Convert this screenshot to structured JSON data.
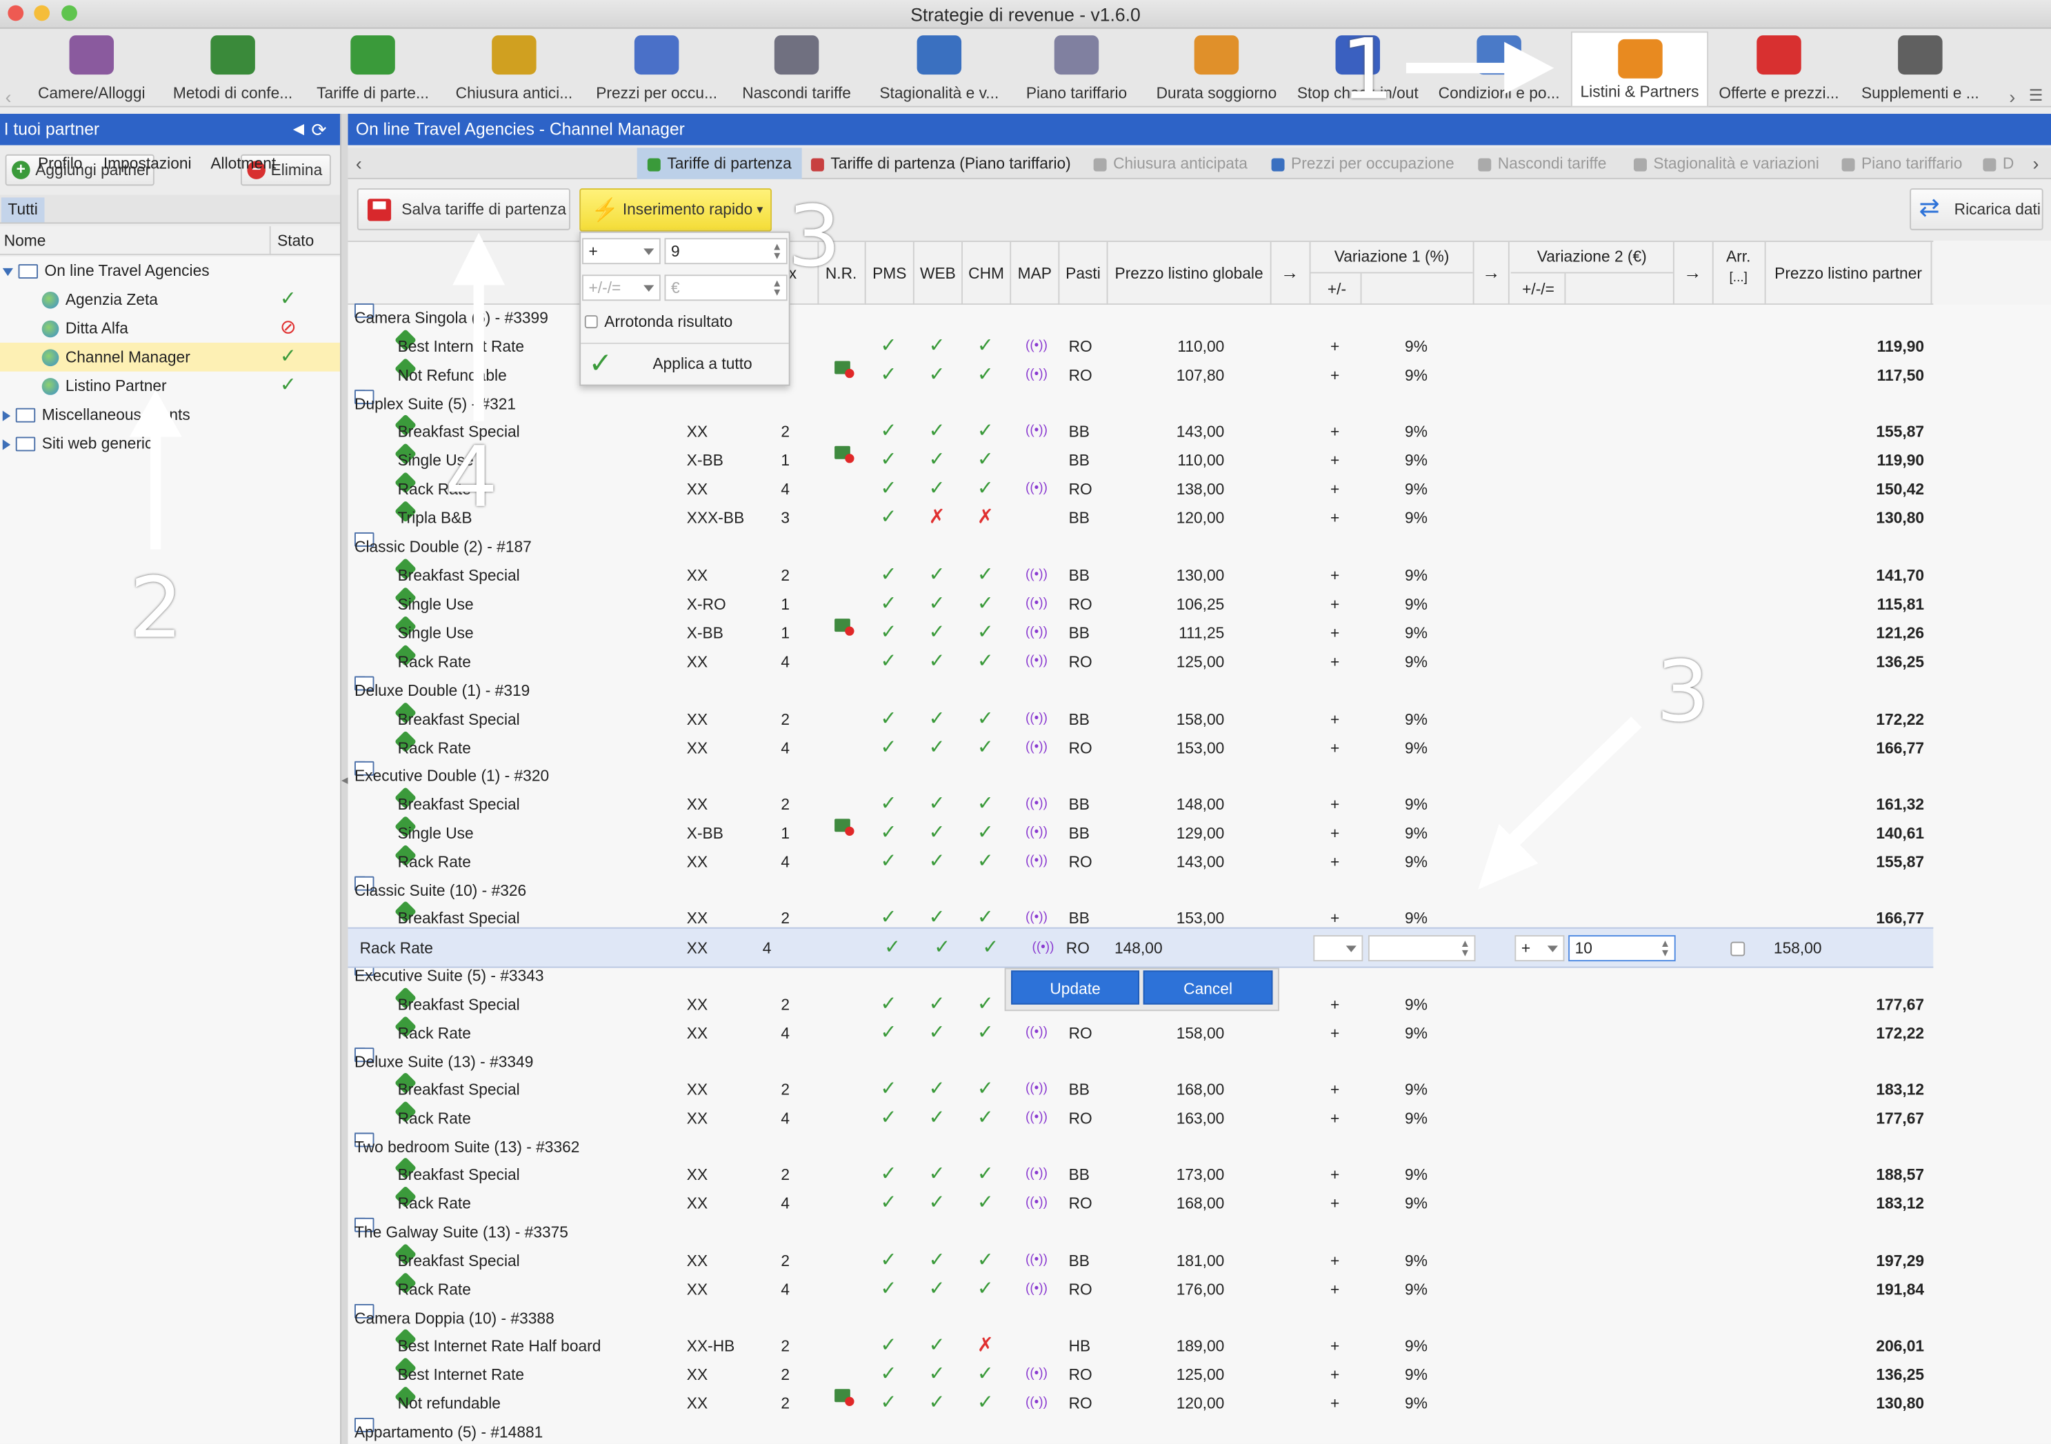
{
  "window": {
    "title": "Strategie di revenue - v1.6.0"
  },
  "toolbar": [
    {
      "label": "Camere/Alloggi",
      "icon": "bed-icon",
      "color": "#8a5a9e"
    },
    {
      "label": "Metodi di confe...",
      "icon": "money-icon",
      "color": "#3a8a3a"
    },
    {
      "label": "Tariffe di parte...",
      "icon": "price-tag-icon",
      "color": "#3a9a3a"
    },
    {
      "label": "Chiusura antici...",
      "icon": "clock-icon",
      "color": "#d0a020"
    },
    {
      "label": "Prezzi per occu...",
      "icon": "bar-chart-icon",
      "color": "#4a70c8"
    },
    {
      "label": "Nascondi tariffe",
      "icon": "hidden-eye-icon",
      "color": "#707080"
    },
    {
      "label": "Stagionalità e v...",
      "icon": "season-calendar-icon",
      "color": "#3a70c0"
    },
    {
      "label": "Piano tariffario",
      "icon": "calendar-grid-icon",
      "color": "#8080a0"
    },
    {
      "label": "Durata soggiorno",
      "icon": "ruler-calendar-icon",
      "color": "#e0902a"
    },
    {
      "label": "Stop check-in/out",
      "icon": "stop-icon",
      "color": "#3a60c0"
    },
    {
      "label": "Condizioni e po...",
      "icon": "document-icon",
      "color": "#4a7ac8"
    },
    {
      "label": "Listini & Partners",
      "icon": "handshake-icon",
      "color": "#e88a20"
    },
    {
      "label": "Offerte e prezzi...",
      "icon": "discount-icon",
      "color": "#d83030"
    },
    {
      "label": "Supplementi e ...",
      "icon": "service-bell-icon",
      "color": "#606060"
    }
  ],
  "sidebar": {
    "title": "I tuoi partner",
    "add_label": "Aggiungi partner",
    "delete_label": "Elimina",
    "filter_tab": "Tutti",
    "col_name": "Nome",
    "col_status": "Stato",
    "groups": [
      {
        "label": "On line Travel Agencies",
        "expanded": true,
        "items": [
          {
            "label": "Agenzia Zeta",
            "status": "✓"
          },
          {
            "label": "Ditta Alfa",
            "status": "⊘"
          },
          {
            "label": "Channel Manager",
            "status": "✓",
            "selected": true
          },
          {
            "label": "Listino Partner",
            "status": "✓"
          }
        ]
      },
      {
        "label": "Miscellaneous clients",
        "expanded": false,
        "items": []
      },
      {
        "label": "Siti web generici",
        "expanded": false,
        "items": []
      }
    ]
  },
  "main": {
    "title": "On line Travel Agencies - Channel Manager",
    "tabs": [
      "Profilo",
      "Impostazioni",
      "Allotment",
      "Tariffe di partenza",
      "Tariffe di partenza (Piano tariffario)",
      "Chiusura anticipata",
      "Prezzi per occupazione",
      "Nascondi tariffe",
      "Stagionalità e variazioni",
      "Piano tariffario",
      "D"
    ],
    "save_label": "Salva tariffe di partenza",
    "quick_label": "Inserimento rapido",
    "reload_label": "Ricarica dati",
    "columns": {
      "x": "x",
      "nr": "N.R.",
      "pms": "PMS",
      "web": "WEB",
      "chm": "CHM",
      "map": "MAP",
      "meals": "Pasti",
      "global": "Prezzo listino globale",
      "arrow": "→",
      "var1": "Variazione 1 (%)",
      "var1_sub": "+/-",
      "var2": "Variazione 2 (€)",
      "var2_sub": "+/-/=",
      "arr": "Arr.",
      "arr_sub": "[...]",
      "partner": "Prezzo listino partner"
    }
  },
  "quick_popup": {
    "op": "+",
    "value": "9",
    "op2_placeholder": "+/-/=",
    "value2_placeholder": "€",
    "round_label": "Arrotonda risultato",
    "apply_label": "Applica a tutto"
  },
  "rows": [
    {
      "type": "g",
      "label": "Camera Singola (6) - #3399"
    },
    {
      "type": "r",
      "label": "Best Internet Rate",
      "code": "",
      "occ": "",
      "nr": false,
      "pms": "✓",
      "web": "✓",
      "chm": "✓",
      "map": true,
      "meal": "RO",
      "price": "110,00",
      "v": "9%",
      "final": "119,90"
    },
    {
      "type": "r",
      "label": "Not Refundable",
      "code": "",
      "occ": "",
      "nr": true,
      "pms": "✓",
      "web": "✓",
      "chm": "✓",
      "map": true,
      "meal": "RO",
      "price": "107,80",
      "v": "9%",
      "final": "117,50"
    },
    {
      "type": "g",
      "label": "Duplex Suite (5) - #321"
    },
    {
      "type": "r",
      "label": "Breakfast Special",
      "code": "XX",
      "occ": "2",
      "nr": false,
      "pms": "✓",
      "web": "✓",
      "chm": "✓",
      "map": true,
      "meal": "BB",
      "price": "143,00",
      "v": "9%",
      "final": "155,87"
    },
    {
      "type": "r",
      "label": "Single Use",
      "code": "X-BB",
      "occ": "1",
      "nr": true,
      "pms": "✓",
      "web": "✓",
      "chm": "✓",
      "map": false,
      "meal": "BB",
      "price": "110,00",
      "v": "9%",
      "final": "119,90"
    },
    {
      "type": "r",
      "label": "Rack Rate",
      "code": "XX",
      "occ": "4",
      "nr": false,
      "pms": "✓",
      "web": "✓",
      "chm": "✓",
      "map": true,
      "meal": "RO",
      "price": "138,00",
      "v": "9%",
      "final": "150,42"
    },
    {
      "type": "r",
      "label": "Tripla B&B",
      "code": "XXX-BB",
      "occ": "3",
      "nr": false,
      "pms": "✓",
      "web": "✗",
      "chm": "✗",
      "map": false,
      "meal": "BB",
      "price": "120,00",
      "v": "9%",
      "final": "130,80"
    },
    {
      "type": "g",
      "label": "Classic Double (2) - #187"
    },
    {
      "type": "r",
      "label": "Breakfast Special",
      "code": "XX",
      "occ": "2",
      "nr": false,
      "pms": "✓",
      "web": "✓",
      "chm": "✓",
      "map": true,
      "meal": "BB",
      "price": "130,00",
      "v": "9%",
      "final": "141,70"
    },
    {
      "type": "r",
      "label": "Single Use",
      "code": "X-RO",
      "occ": "1",
      "nr": false,
      "pms": "✓",
      "web": "✓",
      "chm": "✓",
      "map": true,
      "meal": "RO",
      "price": "106,25",
      "v": "9%",
      "final": "115,81"
    },
    {
      "type": "r",
      "label": "Single Use",
      "code": "X-BB",
      "occ": "1",
      "nr": true,
      "pms": "✓",
      "web": "✓",
      "chm": "✓",
      "map": true,
      "meal": "BB",
      "price": "111,25",
      "v": "9%",
      "final": "121,26"
    },
    {
      "type": "r",
      "label": "Rack Rate",
      "code": "XX",
      "occ": "4",
      "nr": false,
      "pms": "✓",
      "web": "✓",
      "chm": "✓",
      "map": true,
      "meal": "RO",
      "price": "125,00",
      "v": "9%",
      "final": "136,25"
    },
    {
      "type": "g",
      "label": "Deluxe Double (1) - #319"
    },
    {
      "type": "r",
      "label": "Breakfast Special",
      "code": "XX",
      "occ": "2",
      "nr": false,
      "pms": "✓",
      "web": "✓",
      "chm": "✓",
      "map": true,
      "meal": "BB",
      "price": "158,00",
      "v": "9%",
      "final": "172,22"
    },
    {
      "type": "r",
      "label": "Rack Rate",
      "code": "XX",
      "occ": "4",
      "nr": false,
      "pms": "✓",
      "web": "✓",
      "chm": "✓",
      "map": true,
      "meal": "RO",
      "price": "153,00",
      "v": "9%",
      "final": "166,77"
    },
    {
      "type": "g",
      "label": "Executive Double (1) - #320"
    },
    {
      "type": "r",
      "label": "Breakfast Special",
      "code": "XX",
      "occ": "2",
      "nr": false,
      "pms": "✓",
      "web": "✓",
      "chm": "✓",
      "map": true,
      "meal": "BB",
      "price": "148,00",
      "v": "9%",
      "final": "161,32"
    },
    {
      "type": "r",
      "label": "Single Use",
      "code": "X-BB",
      "occ": "1",
      "nr": true,
      "pms": "✓",
      "web": "✓",
      "chm": "✓",
      "map": true,
      "meal": "BB",
      "price": "129,00",
      "v": "9%",
      "final": "140,61"
    },
    {
      "type": "r",
      "label": "Rack Rate",
      "code": "XX",
      "occ": "4",
      "nr": false,
      "pms": "✓",
      "web": "✓",
      "chm": "✓",
      "map": true,
      "meal": "RO",
      "price": "143,00",
      "v": "9%",
      "final": "155,87"
    },
    {
      "type": "g",
      "label": "Classic Suite (10) - #326"
    },
    {
      "type": "r",
      "label": "Breakfast Special",
      "code": "XX",
      "occ": "2",
      "nr": false,
      "pms": "✓",
      "web": "✓",
      "chm": "✓",
      "map": true,
      "meal": "BB",
      "price": "153,00",
      "v": "9%",
      "final": "166,77"
    },
    {
      "type": "edit"
    },
    {
      "type": "g",
      "label": "Executive Suite (5) - #3343"
    },
    {
      "type": "r",
      "label": "Breakfast Special",
      "code": "XX",
      "occ": "2",
      "nr": false,
      "pms": "✓",
      "web": "✓",
      "chm": "✓",
      "map": false,
      "meal": "",
      "price": "",
      "v": "9%",
      "final": "177,67"
    },
    {
      "type": "r",
      "label": "Rack Rate",
      "code": "XX",
      "occ": "4",
      "nr": false,
      "pms": "✓",
      "web": "✓",
      "chm": "✓",
      "map": true,
      "meal": "RO",
      "price": "158,00",
      "v": "9%",
      "final": "172,22"
    },
    {
      "type": "g",
      "label": "Deluxe Suite (13) - #3349"
    },
    {
      "type": "r",
      "label": "Breakfast Special",
      "code": "XX",
      "occ": "2",
      "nr": false,
      "pms": "✓",
      "web": "✓",
      "chm": "✓",
      "map": true,
      "meal": "BB",
      "price": "168,00",
      "v": "9%",
      "final": "183,12"
    },
    {
      "type": "r",
      "label": "Rack Rate",
      "code": "XX",
      "occ": "4",
      "nr": false,
      "pms": "✓",
      "web": "✓",
      "chm": "✓",
      "map": true,
      "meal": "RO",
      "price": "163,00",
      "v": "9%",
      "final": "177,67"
    },
    {
      "type": "g",
      "label": "Two bedroom Suite (13) - #3362"
    },
    {
      "type": "r",
      "label": "Breakfast Special",
      "code": "XX",
      "occ": "2",
      "nr": false,
      "pms": "✓",
      "web": "✓",
      "chm": "✓",
      "map": true,
      "meal": "BB",
      "price": "173,00",
      "v": "9%",
      "final": "188,57"
    },
    {
      "type": "r",
      "label": "Rack Rate",
      "code": "XX",
      "occ": "4",
      "nr": false,
      "pms": "✓",
      "web": "✓",
      "chm": "✓",
      "map": true,
      "meal": "RO",
      "price": "168,00",
      "v": "9%",
      "final": "183,12"
    },
    {
      "type": "g",
      "label": "The Galway Suite (13) - #3375"
    },
    {
      "type": "r",
      "label": "Breakfast Special",
      "code": "XX",
      "occ": "2",
      "nr": false,
      "pms": "✓",
      "web": "✓",
      "chm": "✓",
      "map": true,
      "meal": "BB",
      "price": "181,00",
      "v": "9%",
      "final": "197,29"
    },
    {
      "type": "r",
      "label": "Rack Rate",
      "code": "XX",
      "occ": "4",
      "nr": false,
      "pms": "✓",
      "web": "✓",
      "chm": "✓",
      "map": true,
      "meal": "RO",
      "price": "176,00",
      "v": "9%",
      "final": "191,84"
    },
    {
      "type": "g",
      "label": "Camera Doppia (10) - #3388"
    },
    {
      "type": "r",
      "label": "Best Internet Rate Half board",
      "code": "XX-HB",
      "occ": "2",
      "nr": false,
      "pms": "✓",
      "web": "✓",
      "chm": "✗",
      "map": false,
      "meal": "HB",
      "price": "189,00",
      "v": "9%",
      "final": "206,01"
    },
    {
      "type": "r",
      "label": "Best Internet Rate",
      "code": "XX",
      "occ": "2",
      "nr": false,
      "pms": "✓",
      "web": "✓",
      "chm": "✓",
      "map": true,
      "meal": "RO",
      "price": "125,00",
      "v": "9%",
      "final": "136,25"
    },
    {
      "type": "r",
      "label": "Not refundable",
      "code": "XX",
      "occ": "2",
      "nr": true,
      "pms": "✓",
      "web": "✓",
      "chm": "✓",
      "map": true,
      "meal": "RO",
      "price": "120,00",
      "v": "9%",
      "final": "130,80"
    },
    {
      "type": "g",
      "label": "Appartamento (5) - #14881"
    }
  ],
  "edit_row": {
    "label": "Rack Rate",
    "code": "XX",
    "occ": "4",
    "meal": "RO",
    "price": "148,00",
    "op2": "+",
    "value2": "10",
    "partner": "158,00",
    "update_label": "Update",
    "cancel_label": "Cancel"
  },
  "sign": "+",
  "annotations": [
    "1",
    "2",
    "3",
    "3",
    "4"
  ]
}
